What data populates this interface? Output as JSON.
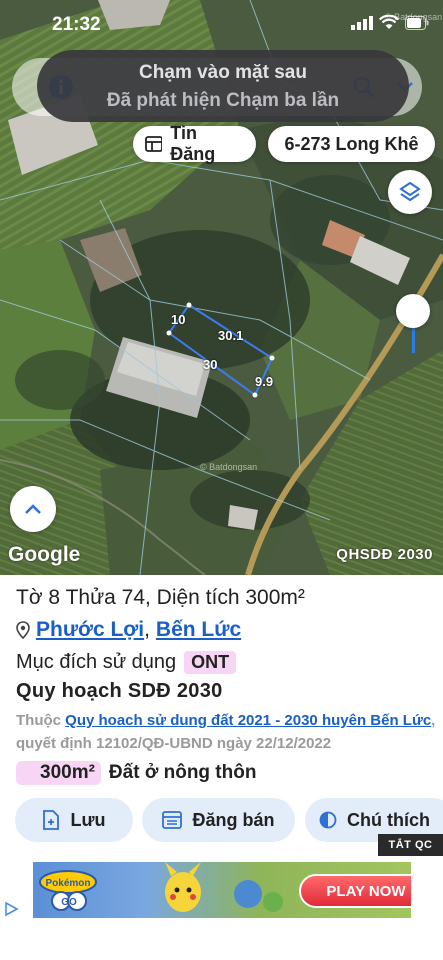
{
  "status_bar": {
    "time": "21:32"
  },
  "toast": {
    "line1": "Chạm vào mặt sau",
    "line2": "Đã phát hiện Chạm ba lần"
  },
  "map": {
    "chip_posts": "Tin Đăng",
    "chip_address": "6-273 Long Khê",
    "dimensions": {
      "top_left": "10",
      "top_right": "30.1",
      "bottom_left": "30",
      "bottom_right": "9.9"
    },
    "watermark": "© Batdongsan",
    "google_label": "Google",
    "layer_label": "QHSDĐ 2030"
  },
  "parcel": {
    "title": "Tờ 8 Thửa 74, Diện tích 300m²",
    "ward": "Phước Lợi",
    "district": "Bến Lức",
    "purpose_label": "Mục đích sử dụng",
    "purpose_code": "ONT",
    "plan_title": "Quy hoạch SDĐ 2030",
    "desc_prefix": "Thuộc",
    "desc_link": "Quy hoach sử dung đất 2021 - 2030 huyên Bến Lức",
    "desc_suffix": ", quyết định 12102/QĐ-UBND ngày 22/12/2022",
    "area_value": "300m²",
    "area_type": "Đất ở nông thôn"
  },
  "actions": {
    "save": "Lưu",
    "sell": "Đăng bán",
    "note": "Chú thích"
  },
  "ad": {
    "close_label": "TẮT QC",
    "cta": "PLAY NOW",
    "brand": "Pokémon GO"
  },
  "colors": {
    "link": "#1a5fc8",
    "badge_pink": "#f7d6f5",
    "action_bg": "#e3edf9"
  }
}
